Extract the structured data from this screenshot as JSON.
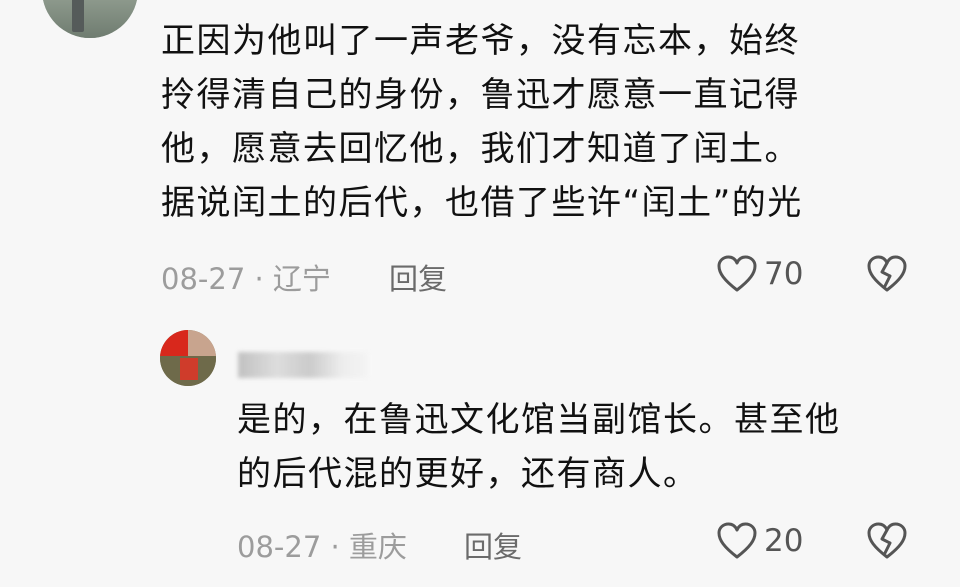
{
  "comment": {
    "lines": [
      "正因为他叫了一声老爷，没有忘本，始终",
      "拎得清自己的身份，鲁迅才愿意一直记得",
      "他，愿意去回忆他，我们才知道了闰土。",
      "据说闰土的后代，也借了些许“闰土”的光"
    ],
    "date_location": "08-27 · 辽宁",
    "reply_label": "回复",
    "like_count": "70",
    "like_icon": "heart-outline-icon",
    "dislike_icon": "broken-heart-icon"
  },
  "reply": {
    "username": "七圈十",
    "lines": [
      "是的，在鲁迅文化馆当副馆长。甚至他",
      "的后代混的更好，还有商人。"
    ],
    "date_location": "08-27 · 重庆",
    "reply_label": "回复",
    "like_count": "20",
    "like_icon": "heart-outline-icon",
    "dislike_icon": "broken-heart-icon"
  },
  "colors": {
    "background": "#f7f7f7",
    "text": "#111111",
    "meta": "#9c9c9c",
    "icon": "#555555"
  }
}
